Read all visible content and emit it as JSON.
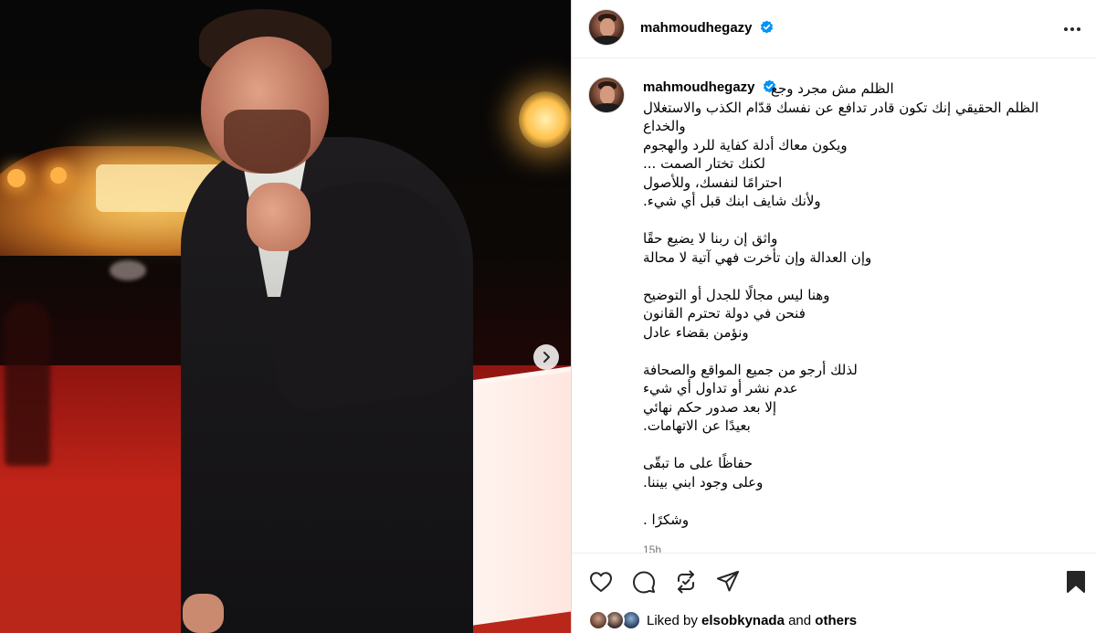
{
  "post": {
    "username": "mahmoudhegazy",
    "verified": true,
    "timestamp": "15h"
  },
  "caption": {
    "lines": [
      "الظلم مش مجرد وجع",
      "الظلم الحقيقي إنك تكون قادر تدافع عن نفسك قدّام الكذب والاستغلال",
      "والخداع",
      "ويكون معاك أدلة كفاية للرد والهجوم",
      "لكنك تختار الصمت ...",
      "احترامًا لنفسك، وللأصول",
      "ولأنك شايف ابنك قبل أي شيء.",
      "",
      "واثق إن ربنا لا يضيع حقًا",
      "وإن العدالة وإن تأخرت فهي آتية لا محالة",
      "",
      "وهنا ليس مجالًا للجدل أو التوضيح",
      "فنحن في دولة تحترم القانون",
      "ونؤمن بقضاء عادل",
      "",
      "لذلك أرجو من جميع المواقع والصحافة",
      "عدم نشر أو تداول أي شيء",
      "إلا بعد صدور حكم نهائي",
      "بعيدًا عن الاتهامات.",
      "",
      "حفاظًا على ما تبقّى",
      "وعلى وجود ابني بيننا.",
      "",
      "وشكرًا ."
    ]
  },
  "likes": {
    "prefix": "Liked by",
    "user": "elsobkynada",
    "conjunction": "and",
    "suffix": "others"
  },
  "icons": {
    "more": "more-horizontal-icon",
    "like": "heart-icon",
    "comment": "comment-icon",
    "repost": "repost-icon",
    "share": "send-icon",
    "save": "bookmark-icon",
    "next": "chevron-right-icon"
  },
  "colors": {
    "verified": "#0095f6",
    "text": "#000000",
    "secondary": "#737373",
    "divider": "#efefef"
  }
}
